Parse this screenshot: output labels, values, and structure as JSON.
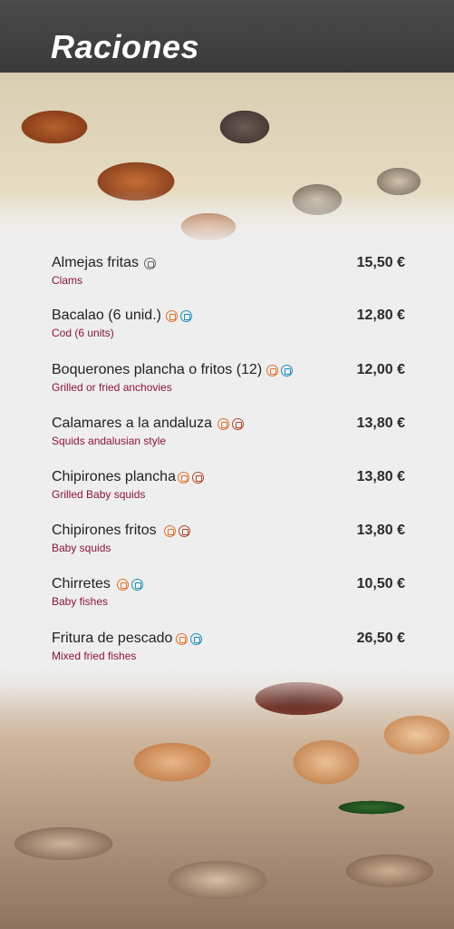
{
  "header": {
    "title": "Raciones"
  },
  "items": [
    {
      "name": "Almejas fritas",
      "icons": [
        "grey"
      ],
      "price": "15,50 €",
      "sub": "Clams"
    },
    {
      "name": "Bacalao (6 unid.)",
      "icons": [
        "orange",
        "blue"
      ],
      "price": "12,80 €",
      "sub": "Cod (6 units)"
    },
    {
      "name": "Boquerones plancha o fritos (12)",
      "icons": [
        "orange",
        "blue"
      ],
      "price": "12,00 €",
      "sub": "Grilled  or fried anchovies"
    },
    {
      "name": "Calamares a la andaluza",
      "icons": [
        "orange",
        "red"
      ],
      "price": "13,80 €",
      "sub": "Squids andalusian style"
    },
    {
      "name": "Chipirones plancha",
      "icons": [
        "orange",
        "red"
      ],
      "price": "13,80 €",
      "sub": "Grilled Baby squids"
    },
    {
      "name": "Chipirones fritos",
      "icons": [
        "orange",
        "red"
      ],
      "price": "13,80 €",
      "sub": "Baby squids"
    },
    {
      "name": "Chirretes",
      "icons": [
        "orange",
        "blue"
      ],
      "price": "10,50 €",
      "sub": "Baby fishes"
    },
    {
      "name": "Fritura de pescado",
      "icons": [
        "orange",
        "blue"
      ],
      "price": "26,50 €",
      "sub": "Mixed fried fishes"
    }
  ]
}
